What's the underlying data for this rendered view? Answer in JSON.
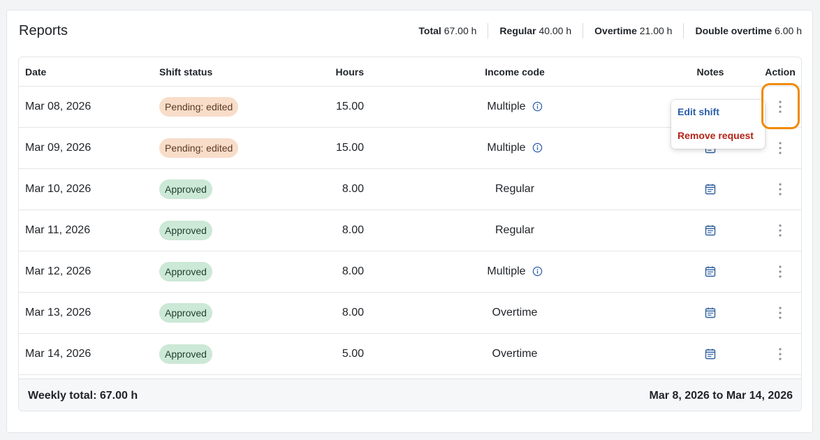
{
  "page": {
    "title": "Reports"
  },
  "summary": [
    {
      "label": "Total",
      "value": "67.00 h"
    },
    {
      "label": "Regular",
      "value": "40.00 h"
    },
    {
      "label": "Overtime",
      "value": "21.00 h"
    },
    {
      "label": "Double overtime",
      "value": "6.00 h"
    }
  ],
  "columns": {
    "date": "Date",
    "status": "Shift status",
    "hours": "Hours",
    "income": "Income code",
    "notes": "Notes",
    "action": "Action"
  },
  "rows": [
    {
      "date": "Mar 08, 2026",
      "status": "Pending: edited",
      "status_type": "pending",
      "hours": "15.00",
      "income": "Multiple",
      "income_info": true,
      "notes_icon": "calendar-note-icon"
    },
    {
      "date": "Mar 09, 2026",
      "status": "Pending: edited",
      "status_type": "pending",
      "hours": "15.00",
      "income": "Multiple",
      "income_info": true,
      "notes_icon": "calendar-note-icon"
    },
    {
      "date": "Mar 10, 2026",
      "status": "Approved",
      "status_type": "approved",
      "hours": "8.00",
      "income": "Regular",
      "income_info": false,
      "notes_icon": "calendar-note-icon"
    },
    {
      "date": "Mar 11, 2026",
      "status": "Approved",
      "status_type": "approved",
      "hours": "8.00",
      "income": "Regular",
      "income_info": false,
      "notes_icon": "calendar-note-icon"
    },
    {
      "date": "Mar 12, 2026",
      "status": "Approved",
      "status_type": "approved",
      "hours": "8.00",
      "income": "Multiple",
      "income_info": true,
      "notes_icon": "calendar-note-icon"
    },
    {
      "date": "Mar 13, 2026",
      "status": "Approved",
      "status_type": "approved",
      "hours": "8.00",
      "income": "Overtime",
      "income_info": false,
      "notes_icon": "calendar-note-icon"
    },
    {
      "date": "Mar 14, 2026",
      "status": "Approved",
      "status_type": "approved",
      "hours": "5.00",
      "income": "Overtime",
      "income_info": false,
      "notes_icon": "calendar-note-icon"
    }
  ],
  "footer": {
    "weekly_total": "Weekly total: 67.00 h",
    "range": "Mar 8, 2026 to Mar 14, 2026"
  },
  "menu": {
    "edit": "Edit shift",
    "remove": "Remove request"
  },
  "colors": {
    "accent_highlight": "#f08a00",
    "pending_bg": "#f8ddc9",
    "approved_bg": "#cce8d6",
    "link_blue": "#2a5ea8",
    "danger_red": "#b42318"
  }
}
